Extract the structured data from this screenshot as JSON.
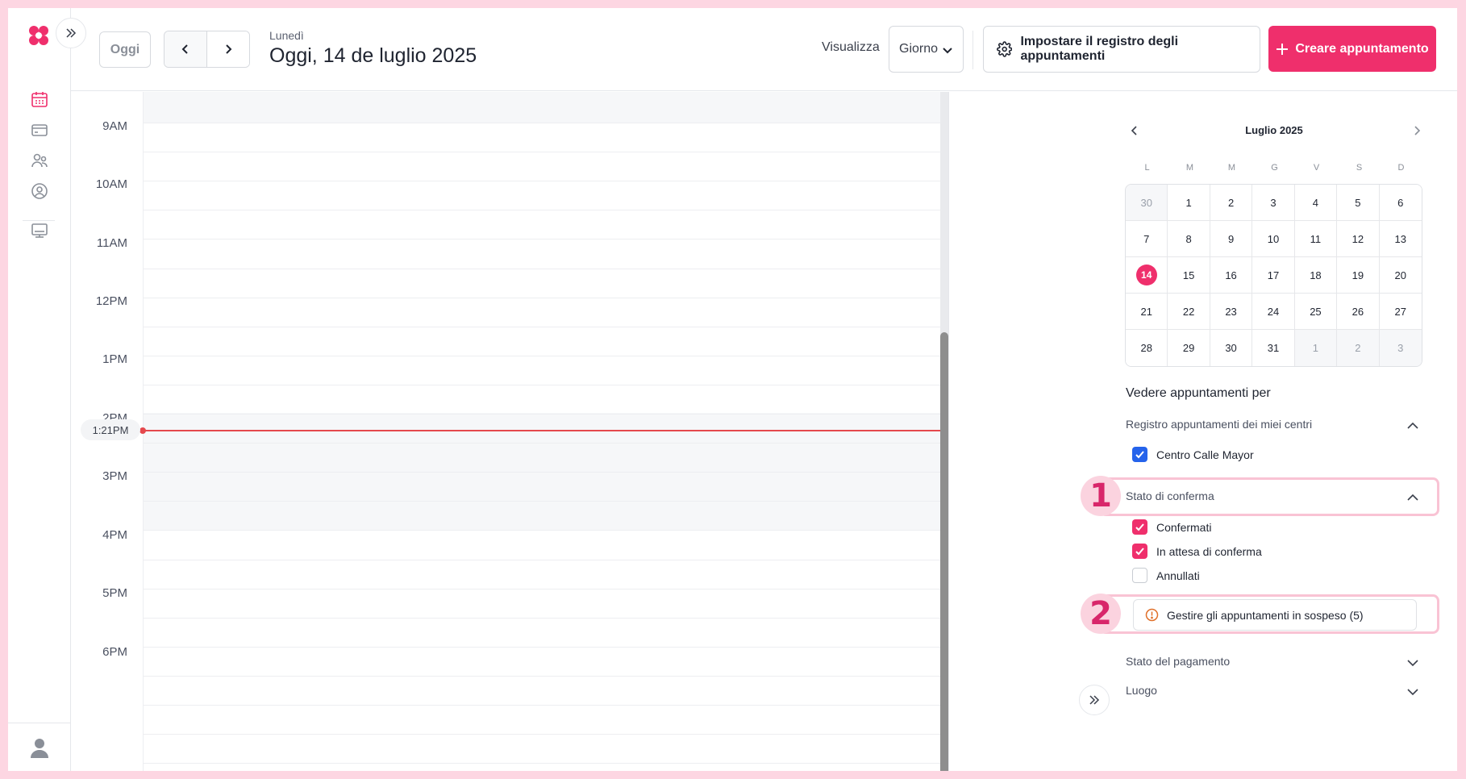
{
  "header": {
    "today_button": "Oggi",
    "weekday": "Lunedì",
    "date_title": "Oggi, 14 de luglio 2025",
    "view_label": "Visualizza",
    "view_value": "Giorno",
    "settings_button": "Impostare il registro degli appuntamenti",
    "create_button": "Creare appuntamento"
  },
  "timeline": {
    "hours": [
      "9AM",
      "10AM",
      "11AM",
      "12PM",
      "1PM",
      "2PM",
      "3PM",
      "4PM",
      "5PM",
      "6PM"
    ],
    "current_time": "1:21PM"
  },
  "mini_calendar": {
    "month_title": "Luglio 2025",
    "weekdays": [
      "L",
      "M",
      "M",
      "G",
      "V",
      "S",
      "D"
    ],
    "days": [
      {
        "d": "30",
        "other": true
      },
      {
        "d": "1"
      },
      {
        "d": "2"
      },
      {
        "d": "3"
      },
      {
        "d": "4"
      },
      {
        "d": "5"
      },
      {
        "d": "6"
      },
      {
        "d": "7"
      },
      {
        "d": "8"
      },
      {
        "d": "9"
      },
      {
        "d": "10"
      },
      {
        "d": "11"
      },
      {
        "d": "12"
      },
      {
        "d": "13"
      },
      {
        "d": "14",
        "today": true
      },
      {
        "d": "15"
      },
      {
        "d": "16"
      },
      {
        "d": "17"
      },
      {
        "d": "18"
      },
      {
        "d": "19"
      },
      {
        "d": "20"
      },
      {
        "d": "21"
      },
      {
        "d": "22"
      },
      {
        "d": "23"
      },
      {
        "d": "24"
      },
      {
        "d": "25"
      },
      {
        "d": "26"
      },
      {
        "d": "27"
      },
      {
        "d": "28"
      },
      {
        "d": "29"
      },
      {
        "d": "30"
      },
      {
        "d": "31"
      },
      {
        "d": "1",
        "other": true
      },
      {
        "d": "2",
        "other": true
      },
      {
        "d": "3",
        "other": true
      }
    ]
  },
  "filters": {
    "section_title": "Vedere appuntamenti per",
    "centers_label": "Registro appuntamenti dei miei centri",
    "center_option": "Centro Calle Mayor",
    "confirmation_label": "Stato di conferma",
    "confirmed": "Confermati",
    "pending": "In attesa di conferma",
    "cancelled": "Annullati",
    "manage_pending": "Gestire gli appuntamenti in sospeso (5)",
    "payment_label": "Stato del pagamento",
    "place_label": "Luogo"
  },
  "annotations": {
    "badge_1": "1",
    "badge_2": "2"
  },
  "colors": {
    "accent": "#ef2f6c",
    "checkbox_blue": "#2563eb",
    "now_line": "#e5484d",
    "highlight": "#f9c3d4"
  }
}
